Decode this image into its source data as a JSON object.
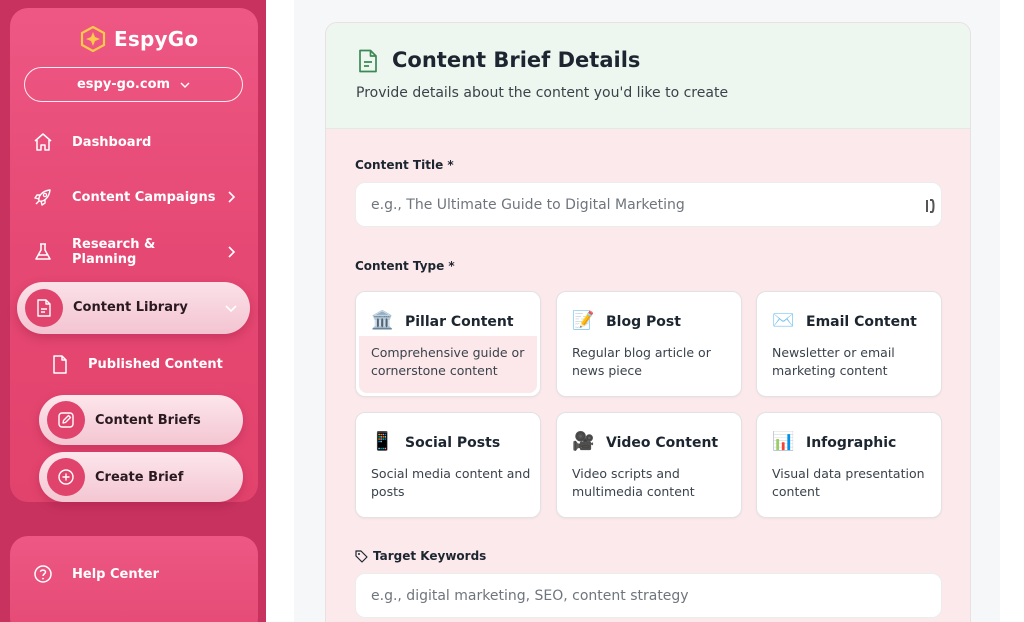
{
  "brand": {
    "name": "EspyGo"
  },
  "domain_selector": {
    "value": "espy-go.com"
  },
  "nav": {
    "dashboard": "Dashboard",
    "content_campaigns": "Content Campaigns",
    "research_planning": "Research & Planning",
    "content_library": "Content Library",
    "published_content": "Published Content",
    "content_briefs": "Content Briefs",
    "create_brief": "Create Brief",
    "help_center": "Help Center"
  },
  "card": {
    "title": "Content Brief Details",
    "subtitle": "Provide details about the content you'd like to create"
  },
  "form": {
    "title_label": "Content Title *",
    "title_placeholder": "e.g., The Ultimate Guide to Digital Marketing",
    "type_label": "Content Type *",
    "keywords_label": "Target Keywords",
    "keywords_placeholder": "e.g., digital marketing, SEO, content strategy"
  },
  "content_types": [
    {
      "emoji": "🏛️",
      "title": "Pillar Content",
      "desc": "Comprehensive guide or cornerstone content"
    },
    {
      "emoji": "📝",
      "title": "Blog Post",
      "desc": "Regular blog article or news piece"
    },
    {
      "emoji": "✉️",
      "title": "Email Content",
      "desc": "Newsletter or email marketing content"
    },
    {
      "emoji": "📱",
      "title": "Social Posts",
      "desc": "Social media content and posts"
    },
    {
      "emoji": "🎥",
      "title": "Video Content",
      "desc": "Video scripts and multimedia content"
    },
    {
      "emoji": "📊",
      "title": "Infographic",
      "desc": "Visual data presentation content"
    }
  ],
  "colors": {
    "sidebar": "#e54873",
    "accent": "#e0436c",
    "header_bg": "#eef7ef",
    "card_bg": "#fce9ec"
  }
}
